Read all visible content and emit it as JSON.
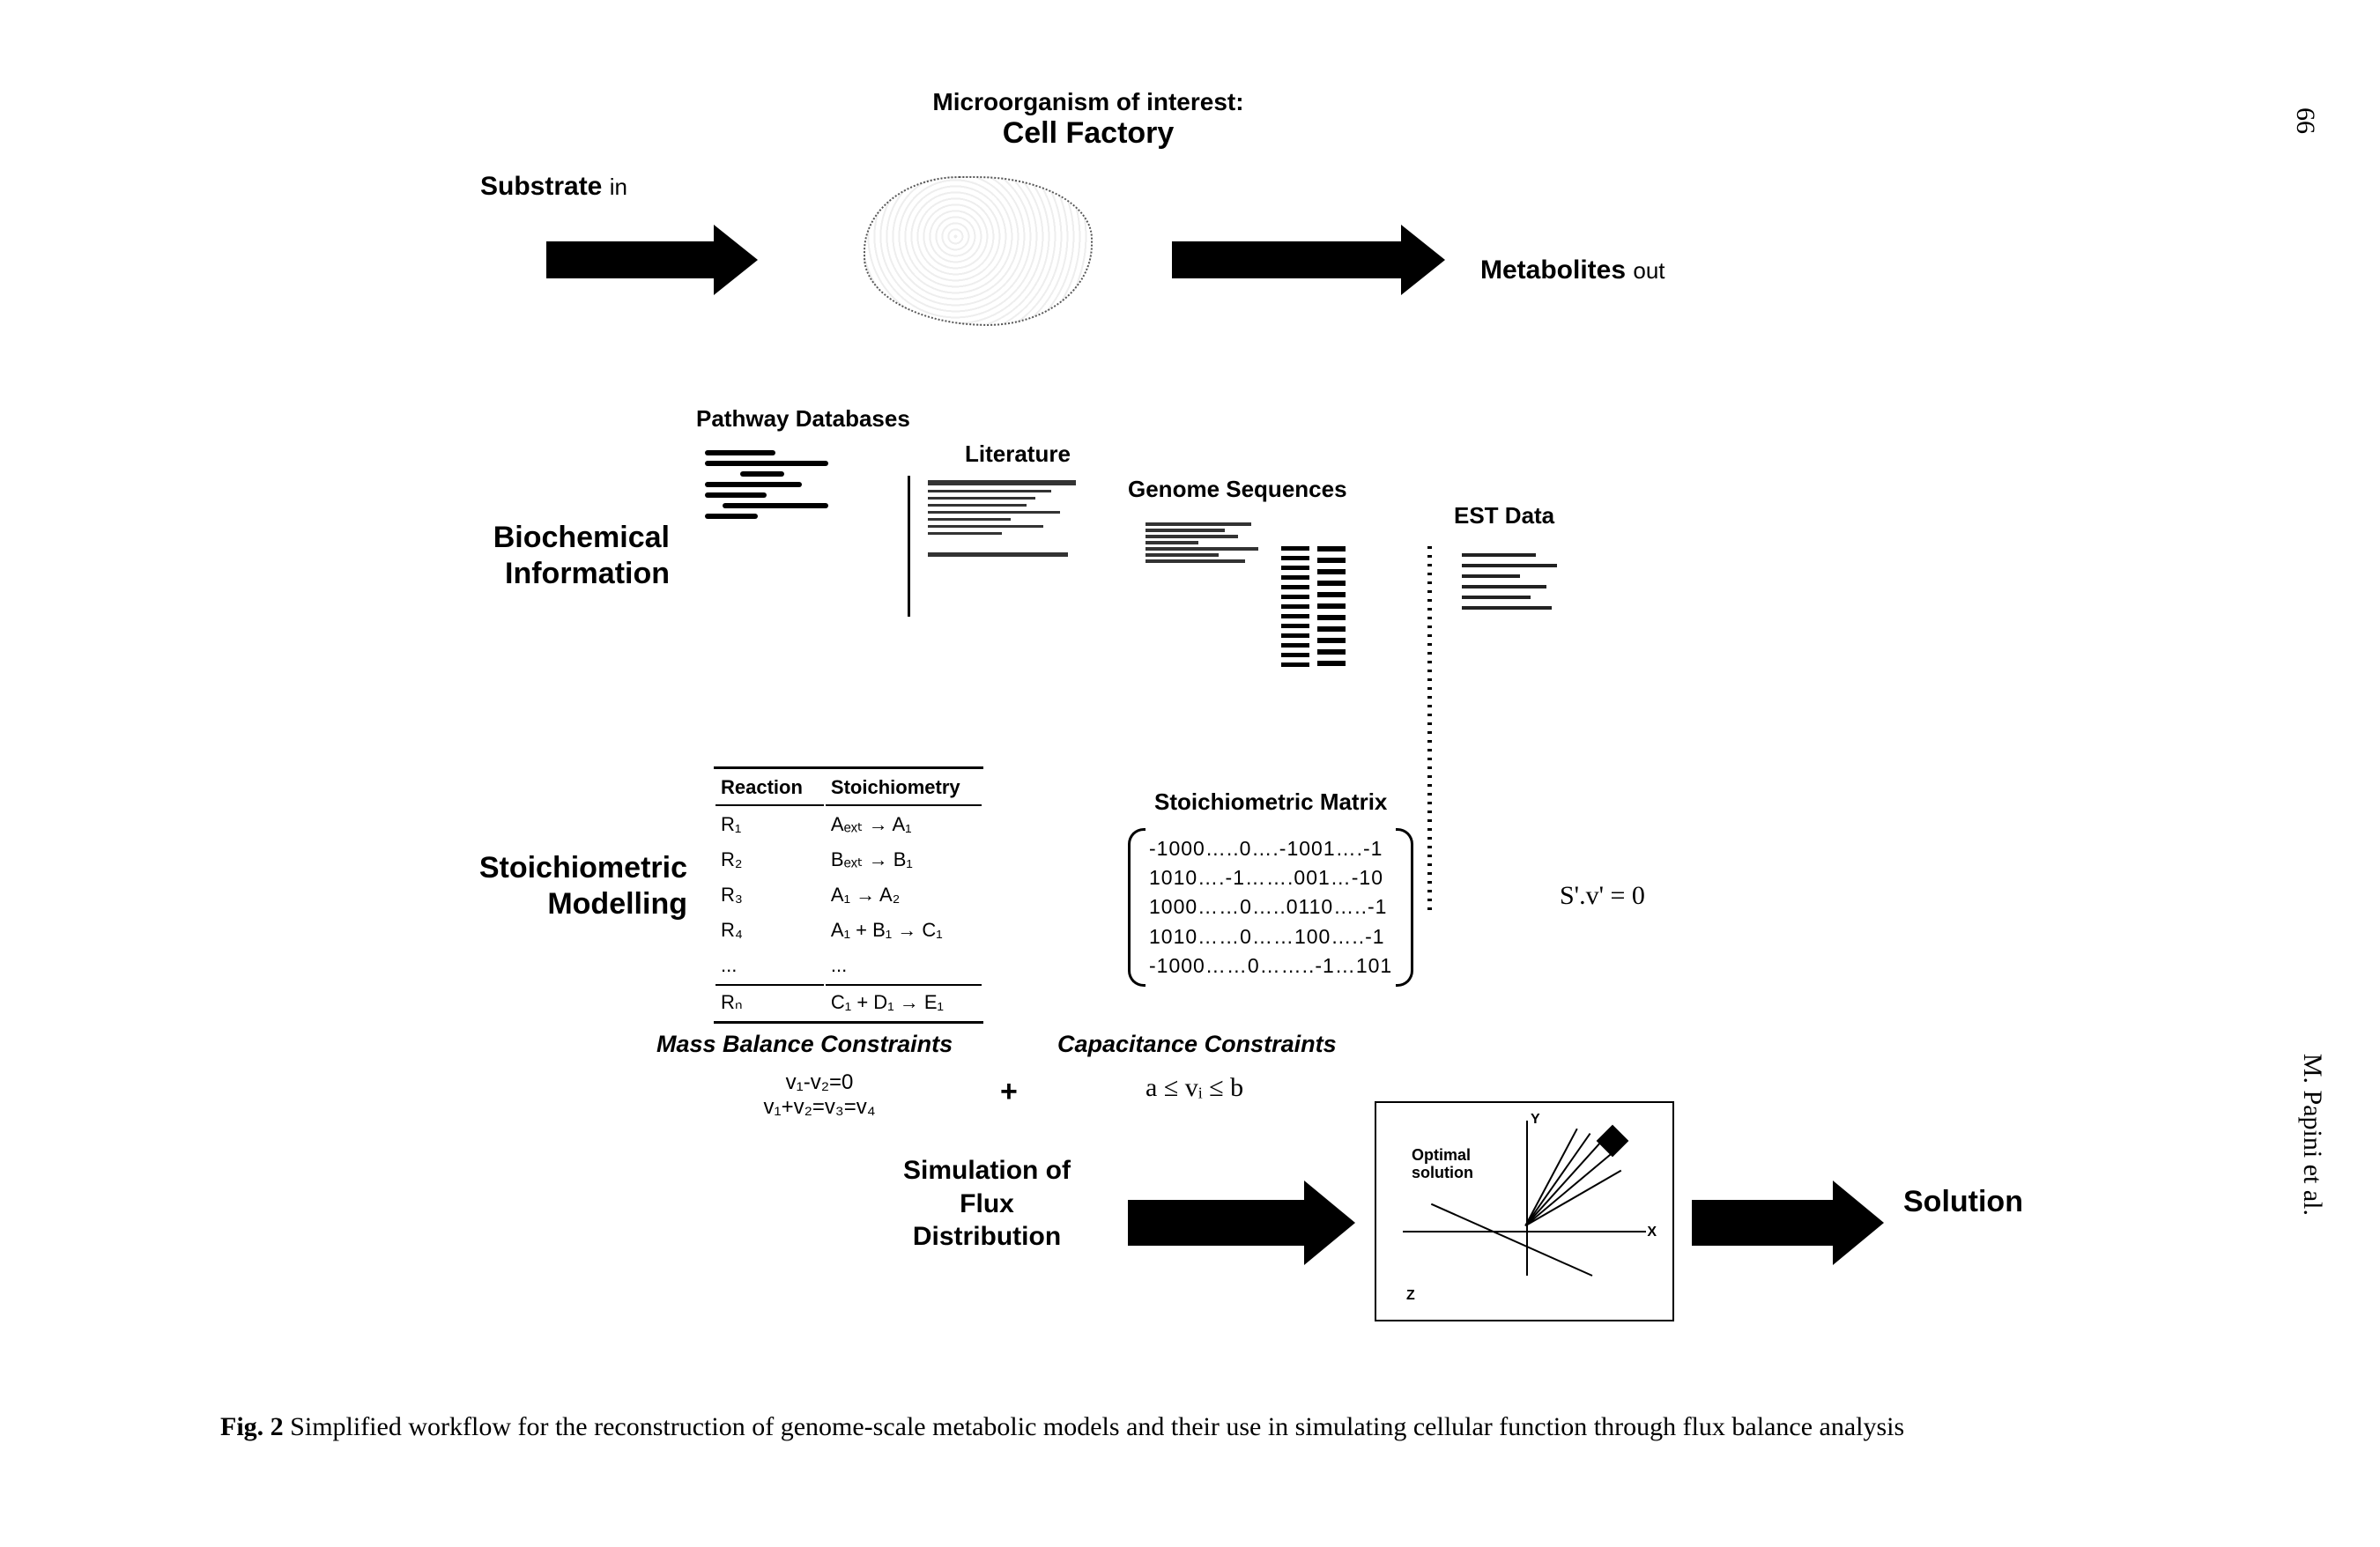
{
  "page_number": "66",
  "author_running": "M. Papini et al.",
  "top": {
    "substrate_label": "Substrate",
    "substrate_suffix": "in",
    "micro_label1": "Microorganism of interest:",
    "micro_label2": "Cell Factory",
    "metabolites_label": "Metabolites",
    "metabolites_suffix": "out"
  },
  "bio": {
    "section_label": "Biochemical\nInformation",
    "pathway_db": "Pathway Databases",
    "literature": "Literature",
    "genome_seq": "Genome Sequences",
    "est_data": "EST Data"
  },
  "stoich": {
    "section_label": "Stoichiometric\nModelling",
    "table_h1": "Reaction",
    "table_h2": "Stoichiometry",
    "rows": [
      {
        "r": "R₁",
        "s": "Aₑₓₜ → A₁"
      },
      {
        "r": "R₂",
        "s": "Bₑₓₜ → B₁"
      },
      {
        "r": "R₃",
        "s": "A₁ → A₂"
      },
      {
        "r": "R₄",
        "s": "A₁ + B₁ → C₁"
      },
      {
        "r": "...",
        "s": "..."
      },
      {
        "r": "Rₙ",
        "s": "C₁ + D₁ → E₁"
      }
    ],
    "matrix_title": "Stoichiometric Matrix",
    "matrix_rows": "-1000…..0….-1001….-1\n1010….-1…….001…-10\n1000……0…..0110…..-1\n1010……0……100…..-1\n-1000……0……..-1…101",
    "equation": "S'.v' = 0"
  },
  "constraints": {
    "mass_title": "Mass Balance Constraints",
    "mass_eq1": "v₁-v₂=0",
    "mass_eq2": "v₁+v₂=v₃=v₄",
    "plus": "+",
    "cap_title": "Capacitance Constraints",
    "cap_eq": "a ≤ vᵢ ≤ b"
  },
  "sim": {
    "label": "Simulation of\nFlux\nDistribution",
    "opt_label": "Optimal\nsolution",
    "axis_x": "X",
    "axis_y": "Y",
    "axis_z": "Z",
    "solution_label": "Solution"
  },
  "caption": {
    "figlabel": "Fig. 2",
    "text": " Simplified workflow for the reconstruction of genome-scale metabolic models and their use in simulating cellular function through flux balance analysis"
  }
}
